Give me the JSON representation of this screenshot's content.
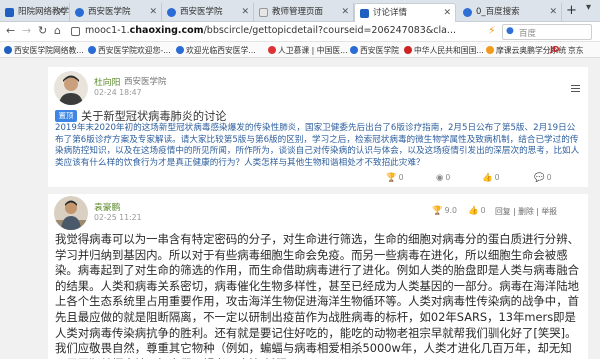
{
  "browser": {
    "tabs": [
      {
        "label": "阳院网络教学平",
        "active": false
      },
      {
        "label": "西安医学院",
        "active": false
      },
      {
        "label": "西安医学院",
        "active": false
      },
      {
        "label": "教师管理页面",
        "active": false
      },
      {
        "label": "讨论详情",
        "active": true
      },
      {
        "label": "0_百度搜索",
        "active": false
      }
    ],
    "url_prefix": "mooc1-1.",
    "url_domain": "chaoxing.com",
    "url_rest": "/bbscircle/gettopicdetail?courseid=206247083&cla...",
    "search_placeholder": "百度"
  },
  "bookmarks": [
    "西安医学院网络教...",
    "西安医学院欢迎您-...",
    "欢迎光临西安医学...",
    "人卫慕课 | 中国医...",
    "西安医学院",
    "中华人民共和国国...",
    "摩课云奥鹏学分系统",
    "JD",
    "京东"
  ],
  "post": {
    "author": "杜向阳",
    "school": "西安医学院",
    "time": "02-24 18:47",
    "tag": "置顶",
    "title": "关于新型冠状病毒肺炎的讨论",
    "body": "2019年末2020年初的这场新型冠状病毒感染爆发的传染性肺炎，国家卫健委先后出台了6版诊疗指南，2月5日公布了第5版、2月19日公布了第6版诊疗方案及专家解读。请大家比较第5版与第6版的区别，学习之后，检索冠状病毒的微生物学属性及致病机制，结合已学过的传染病防控知识，以及在这场疫情中的所见所闻，所作所为，谈谈自己对传染病的认识与体会，以及这场疫情引发出的深层次的思考，比如人类应该有什么样的饮食行为才是真正健康的行为？人类怎样与其他生物和谐相处才不致招此灾难？"
  },
  "reply": {
    "author": "袁豪鹏",
    "time": "02-25 11:21",
    "score": "9.0",
    "actions": "回复 | 删除 | 举报",
    "body": "我觉得病毒可以为一串含有特定密码的分子，对生命进行筛选，生命的细胞对病毒分的蛋白质进行分辨、学习并归纳到基因内。所以对于有些病毒细胞生命会免疫。而另一些病毒在进化，所以细胞生命会被感染。病毒起到了对生命的筛选的作用，而生命借助病毒进行了进化。例如人类的胎盘即是人类与病毒融合的结果。人类和病毒关系密切，病毒催化生物多样性，甚至已经成为人类基因的一部分。病毒在海洋陆地上各个生态系统里占用重要作用，攻击海洋生物促进海洋生物循环等。人类对病毒性传染病的战争中，首先且最应做的就是阻断隔离，不一定以研制出疫苗作为战胜病毒的标杆，如02年SARS，13年mers即是人类对病毒传染病抗争的胜利。还有就是要记住好吃的，能吃的动物老祖宗早就帮我们驯化好了[笑哭]。我们应敬畏自然，尊重其它物种（例如，蝙蝠与病毒相爱相杀5000w年，人类才进化几百万年，却无知无畏冒犯其栖息地，把它们一锅煮了吃掉[托腮]"
  },
  "colors": {
    "link": "#2e5f9e",
    "accent": "#3d86e6",
    "author": "#5a8a2a"
  }
}
